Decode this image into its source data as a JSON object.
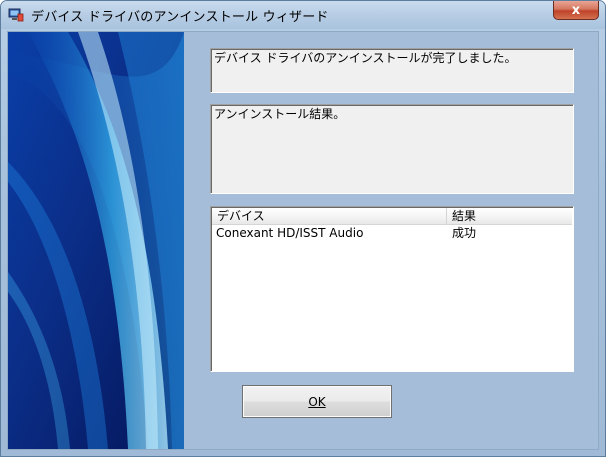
{
  "window": {
    "title": "デバイス ドライバのアンインストール ウィザード",
    "close_glyph": "x"
  },
  "messages": {
    "completed": "デバイス ドライバのアンインストールが完了しました。",
    "result_label": "アンインストール結果。"
  },
  "results_table": {
    "columns": [
      "デバイス",
      "結果"
    ],
    "rows": [
      {
        "device": "Conexant HD/ISST Audio",
        "result": "成功"
      }
    ]
  },
  "buttons": {
    "ok_label": "OK"
  },
  "colors": {
    "titlebar": "#b7cde4",
    "client_background": "#a5bdd8",
    "side_panel_dark": "#061c6a",
    "side_panel_light": "#2fb6ee",
    "close_button": "#c0432a"
  }
}
